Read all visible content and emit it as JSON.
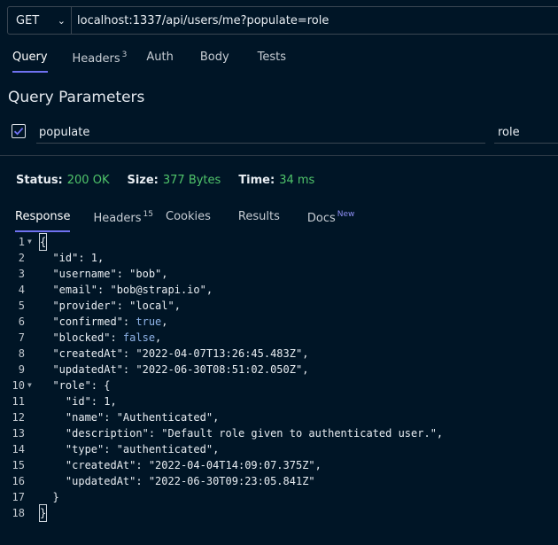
{
  "request": {
    "method": "GET",
    "url": "localhost:1337/api/users/me?populate=role"
  },
  "request_tabs": [
    {
      "label": "Query",
      "count": "",
      "active": true
    },
    {
      "label": "Headers",
      "count": "3",
      "active": false
    },
    {
      "label": "Auth",
      "count": "",
      "active": false
    },
    {
      "label": "Body",
      "count": "",
      "active": false
    },
    {
      "label": "Tests",
      "count": "",
      "active": false
    }
  ],
  "query": {
    "title": "Query Parameters",
    "params": [
      {
        "checked": true,
        "key": "populate",
        "value": "role"
      }
    ]
  },
  "status_bar": {
    "status_label": "Status:",
    "status_value": "200 OK",
    "size_label": "Size:",
    "size_value": "377 Bytes",
    "time_label": "Time:",
    "time_value": "34 ms"
  },
  "response_tabs": [
    {
      "label": "Response",
      "badge": "",
      "active": true
    },
    {
      "label": "Headers",
      "badge": "15",
      "active": false
    },
    {
      "label": "Cookies",
      "badge": "",
      "active": false
    },
    {
      "label": "Results",
      "badge": "",
      "active": false
    },
    {
      "label": "Docs",
      "badge": "New",
      "active": false
    }
  ],
  "response_body": [
    {
      "n": "1",
      "fold": true,
      "text": "{"
    },
    {
      "n": "2",
      "fold": false,
      "text": "  \"id\": 1,"
    },
    {
      "n": "3",
      "fold": false,
      "text": "  \"username\": \"bob\","
    },
    {
      "n": "4",
      "fold": false,
      "text": "  \"email\": \"bob@strapi.io\","
    },
    {
      "n": "5",
      "fold": false,
      "text": "  \"provider\": \"local\","
    },
    {
      "n": "6",
      "fold": false,
      "text": "  \"confirmed\": true,"
    },
    {
      "n": "7",
      "fold": false,
      "text": "  \"blocked\": false,"
    },
    {
      "n": "8",
      "fold": false,
      "text": "  \"createdAt\": \"2022-04-07T13:26:45.483Z\","
    },
    {
      "n": "9",
      "fold": false,
      "text": "  \"updatedAt\": \"2022-06-30T08:51:02.050Z\","
    },
    {
      "n": "10",
      "fold": true,
      "text": "  \"role\": {"
    },
    {
      "n": "11",
      "fold": false,
      "text": "    \"id\": 1,"
    },
    {
      "n": "12",
      "fold": false,
      "text": "    \"name\": \"Authenticated\","
    },
    {
      "n": "13",
      "fold": false,
      "text": "    \"description\": \"Default role given to authenticated user.\","
    },
    {
      "n": "14",
      "fold": false,
      "text": "    \"type\": \"authenticated\","
    },
    {
      "n": "15",
      "fold": false,
      "text": "    \"createdAt\": \"2022-04-04T14:09:07.375Z\","
    },
    {
      "n": "16",
      "fold": false,
      "text": "    \"updatedAt\": \"2022-06-30T09:23:05.841Z\""
    },
    {
      "n": "17",
      "fold": false,
      "text": "  }"
    },
    {
      "n": "18",
      "fold": false,
      "text": "}"
    }
  ],
  "colors": {
    "accent": "#6f71f0",
    "success": "#4fc46a",
    "background": "#001526"
  }
}
